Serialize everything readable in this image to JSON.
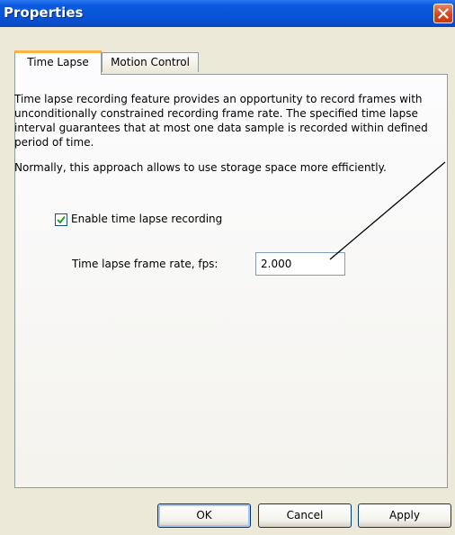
{
  "window": {
    "title": "Properties"
  },
  "tabs": [
    {
      "label": "Time Lapse",
      "active": true
    },
    {
      "label": "Motion Control",
      "active": false
    }
  ],
  "time_lapse": {
    "description": "Time lapse recording feature provides an opportunity to record frames with unconditionally constrained recording frame rate. The specified time lapse interval guarantees that at most one data sample is recorded within defined period of time.",
    "description2": "Normally, this approach allows to use storage space more efficiently.",
    "enable_checkbox": {
      "label": "Enable time lapse recording",
      "checked": true
    },
    "frame_rate": {
      "label": "Time lapse frame rate, fps:",
      "value": "2.000"
    }
  },
  "buttons": {
    "ok": "OK",
    "cancel": "Cancel",
    "apply": "Apply"
  },
  "icons": {
    "close": "close-icon",
    "check": "checkmark-icon"
  },
  "colors": {
    "titlebar": "#0854d8",
    "close_button": "#d8461e",
    "tab_highlight": "#f9b440",
    "dialog_bg": "#ece9d8",
    "checkmark": "#21a121"
  }
}
